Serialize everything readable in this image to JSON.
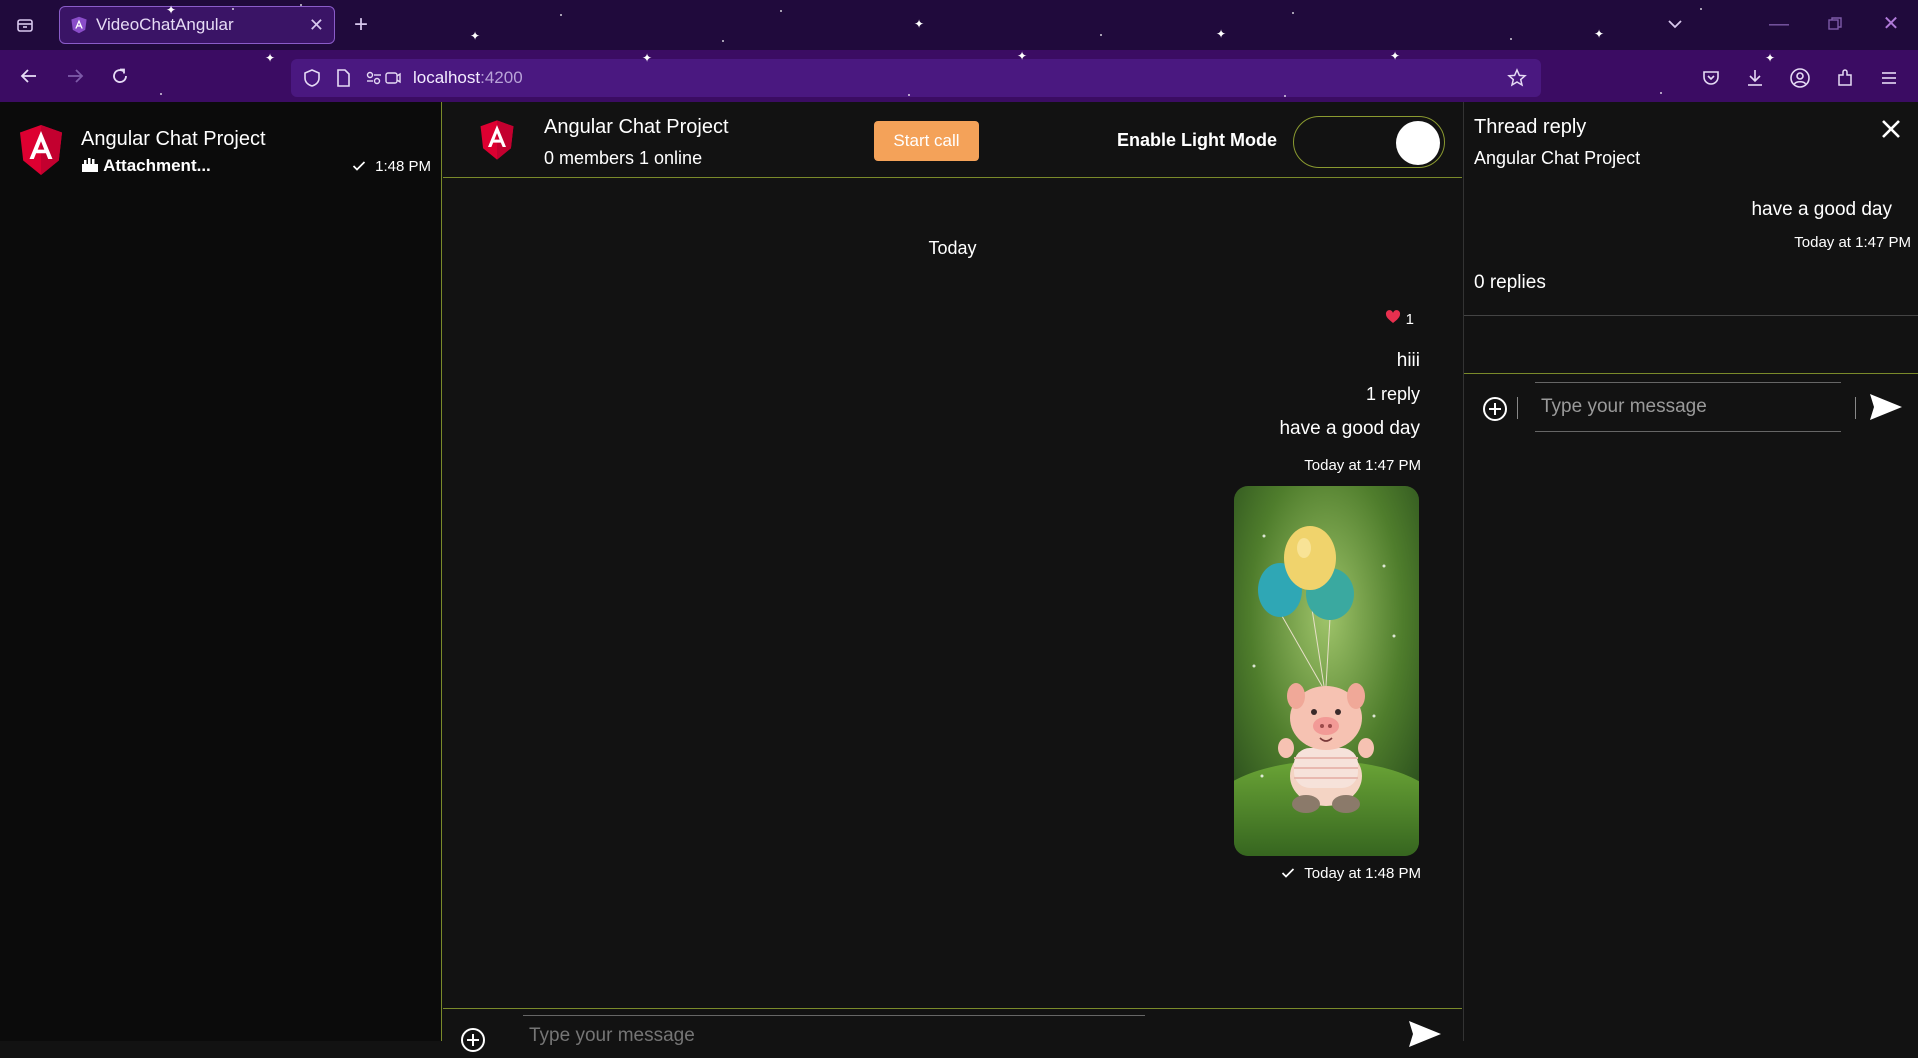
{
  "browser": {
    "tab_title": "VideoChatAngular",
    "url_host": "localhost",
    "url_port": ":4200",
    "icons": [
      "tab-list-icon",
      "close-icon",
      "plus-icon",
      "chevron-down-icon",
      "minimize-icon",
      "restore-icon",
      "window-close-icon",
      "back-icon",
      "forward-icon",
      "reload-icon",
      "shield-icon",
      "page-icon",
      "permissions-icon",
      "bookmark-star-icon",
      "pocket-icon",
      "download-icon",
      "account-icon",
      "extensions-icon",
      "menu-icon"
    ]
  },
  "sidebar": {
    "channel_name": "Angular Chat Project",
    "preview": "Attachment...",
    "time": "1:48 PM"
  },
  "main": {
    "title": "Angular Chat Project",
    "subtitle": "0 members 1 online",
    "start_call_label": "Start call",
    "mode_label": "Enable Light Mode",
    "date_separator": "Today",
    "reaction_count": "1",
    "message1": "hiii",
    "reply_count": "1 reply",
    "message2": "have a good day",
    "message2_time": "Today at 1:47 PM",
    "attachment_time": "Today at 1:48 PM",
    "composer_placeholder": "Type your message"
  },
  "thread": {
    "title": "Thread reply",
    "subtitle": "Angular Chat Project",
    "message": "have a good day",
    "time": "Today at 1:47 PM",
    "replies": "0 replies",
    "placeholder": "Type your message"
  },
  "colors": {
    "accent_border": "#7a8a2a",
    "start_call": "#f4a259",
    "angular_red": "#dd0031",
    "browser_tabbar": "#200a3c",
    "browser_navbar": "#3b0c63"
  }
}
